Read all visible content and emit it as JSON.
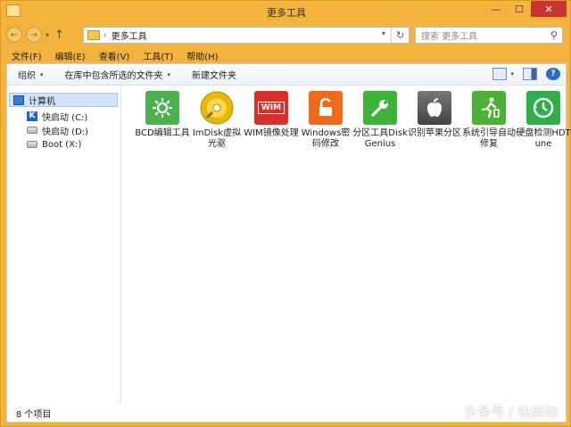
{
  "window": {
    "title": "更多工具",
    "controls": {
      "minimize": "—",
      "maximize": "☐",
      "close": "✕"
    }
  },
  "nav": {
    "back": "←",
    "forward": "→",
    "dropdown": "▾",
    "up": "↑",
    "address_sep": "›",
    "address_path": "更多工具",
    "address_dropdown": "▾",
    "refresh": "↻",
    "search_placeholder": "搜索 更多工具",
    "search_icon": "⚲"
  },
  "menubar": {
    "items": [
      {
        "label": "文件(F)"
      },
      {
        "label": "编辑(E)"
      },
      {
        "label": "查看(V)"
      },
      {
        "label": "工具(T)"
      },
      {
        "label": "帮助(H)"
      }
    ]
  },
  "toolbar": {
    "organize": "组织",
    "include_in_library": "在库中包含所选的文件夹",
    "new_folder": "新建文件夹",
    "caret": "▾",
    "help_icon": "?"
  },
  "sidebar": {
    "items": [
      {
        "label": "计算机",
        "icon": "computer-icon",
        "selected": true
      },
      {
        "label": "快启动 (C:)",
        "icon": "k-drive-icon",
        "glyph": "K"
      },
      {
        "label": "快启动 (D:)",
        "icon": "drive-icon"
      },
      {
        "label": "Boot (X:)",
        "icon": "drive-icon"
      }
    ]
  },
  "files": [
    {
      "name": "BCD编辑工具",
      "icon": "gear-icon",
      "color": "#4caf50"
    },
    {
      "name": "ImDisk虚拟光驱",
      "icon": "cd-icon",
      "color": "#e6b800"
    },
    {
      "name": "WIM镜像处理",
      "icon": "wim-icon",
      "color": "#d9302b",
      "badge": "WIM"
    },
    {
      "name": "Windows密码修改",
      "icon": "unlock-icon",
      "color": "#f06a1d"
    },
    {
      "name": "分区工具DiskGenius",
      "icon": "wrench-icon",
      "color": "#3fb23a"
    },
    {
      "name": "识别苹果分区",
      "icon": "apple-icon",
      "color": "#555555"
    },
    {
      "name": "系统引导自动修复",
      "icon": "runner-icon",
      "color": "#4ab337"
    },
    {
      "name": "硬盘检测HDTune",
      "icon": "clock-icon",
      "color": "#2fae4a"
    }
  ],
  "statusbar": {
    "text": "8 个项目"
  },
  "watermark": "头条号 / 快启动"
}
